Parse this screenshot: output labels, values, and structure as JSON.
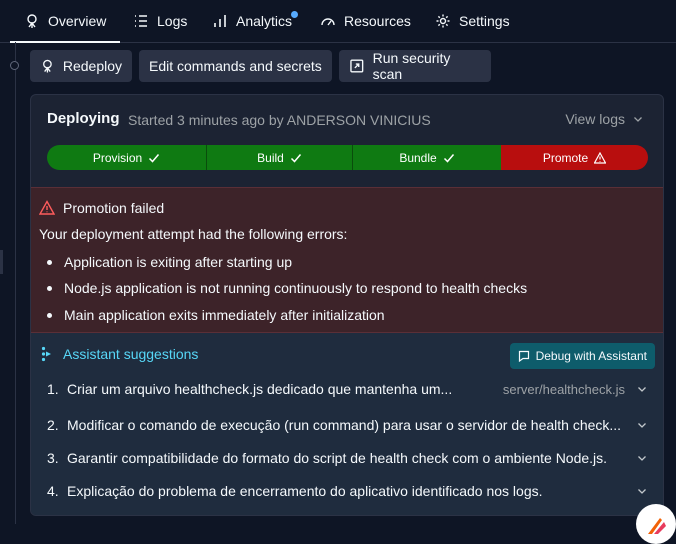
{
  "tabs": [
    {
      "label": "Overview",
      "icon": "deployment-icon"
    },
    {
      "label": "Logs",
      "icon": "list-icon"
    },
    {
      "label": "Analytics",
      "icon": "bar-chart-icon"
    },
    {
      "label": "Resources",
      "icon": "gauge-icon"
    },
    {
      "label": "Settings",
      "icon": "gear-icon"
    }
  ],
  "actions": {
    "redeploy": "Redeploy",
    "edit_commands": "Edit commands and secrets",
    "security_scan": "Run security scan"
  },
  "deployment": {
    "title": "Deploying",
    "subtitle": "Started 3 minutes ago by ANDERSON VINICIUS",
    "view_logs": "View logs"
  },
  "pipeline": {
    "stages": [
      {
        "label": "Provision",
        "status": "success",
        "color": "#0f7a12"
      },
      {
        "label": "Build",
        "status": "success",
        "color": "#0f7a12"
      },
      {
        "label": "Bundle",
        "status": "success",
        "color": "#0f7a12"
      },
      {
        "label": "Promote",
        "status": "error",
        "color": "#b80e0e"
      }
    ]
  },
  "error": {
    "title": "Promotion failed",
    "intro": "Your deployment attempt had the following errors:",
    "items": [
      "Application is exiting after starting up",
      "Node.js application is not running continuously to respond to health checks",
      "Main application exits immediately after initialization"
    ]
  },
  "assistant": {
    "title": "Assistant suggestions",
    "debug_button": "Debug with Assistant",
    "suggestions": [
      {
        "num": "1.",
        "text": "Criar um arquivo healthcheck.js dedicado que mantenha um...",
        "path": "server/healthcheck.js"
      },
      {
        "num": "2.",
        "text": "Modificar o comando de execução (run command) para usar o servidor de health check...",
        "path": ""
      },
      {
        "num": "3.",
        "text": "Garantir compatibilidade do formato do script de health check com o ambiente Node.js.",
        "path": ""
      },
      {
        "num": "4.",
        "text": "Explicação do problema de encerramento do aplicativo identificado nos logs.",
        "path": ""
      }
    ]
  },
  "colors": {
    "background": "#0e1525",
    "card": "#1c2333",
    "success": "#0f7a12",
    "error": "#b80e0e",
    "accent": "#57d7f7"
  }
}
